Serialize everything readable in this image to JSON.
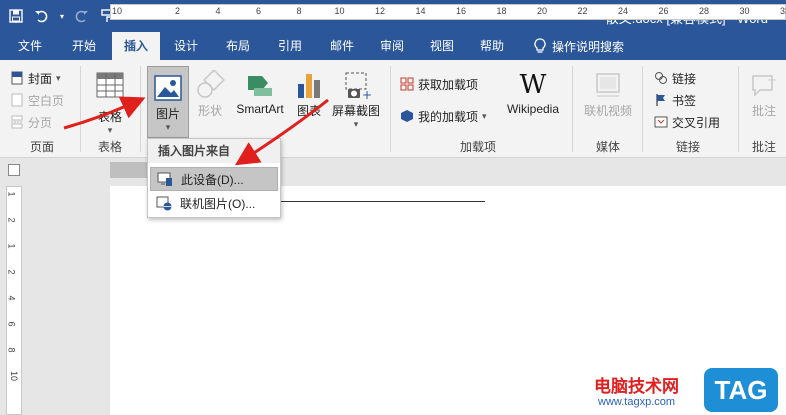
{
  "title": {
    "text": "散文.docx [兼容模式]  -  Word"
  },
  "qat": {
    "save": "save-icon",
    "undo": "undo-icon",
    "redo": "redo-icon",
    "format_painter": "format-painter-icon",
    "customize": "▾"
  },
  "tabs": [
    "文件",
    "开始",
    "插入",
    "设计",
    "布局",
    "引用",
    "邮件",
    "审阅",
    "视图",
    "帮助"
  ],
  "tellme": "操作说明搜索",
  "ribbon": {
    "pages": {
      "cover": "封面",
      "blank": "空白页",
      "break": "分页",
      "group": "页面"
    },
    "tables": {
      "table": "表格",
      "group": "表格"
    },
    "illustrations": {
      "pictures": "图片",
      "shapes": "形状",
      "smartart": "SmartArt",
      "chart": "图表",
      "screenshot": "屏幕截图"
    },
    "addins": {
      "get": "获取加载项",
      "my": "我的加载项",
      "wikipedia": "Wikipedia",
      "group": "加载项"
    },
    "media": {
      "online_video": "联机视频",
      "group": "媒体"
    },
    "links": {
      "link": "链接",
      "bookmark": "书签",
      "crossref": "交叉引用",
      "group": "链接"
    },
    "comments": {
      "comment": "批注",
      "group": "批注"
    }
  },
  "dropdown": {
    "header": "插入图片来自",
    "items": [
      "此设备(D)...",
      "联机图片(O)..."
    ]
  },
  "ruler": {
    "ticks": [
      "10",
      "2",
      "4",
      "6",
      "8",
      "10",
      "12",
      "14",
      "16",
      "18",
      "20",
      "22",
      "24",
      "26",
      "28",
      "30",
      "32"
    ],
    "vticks": [
      "1",
      "2",
      "1",
      "2",
      "4",
      "6",
      "8",
      "10"
    ]
  },
  "watermark": {
    "text": "电脑技术网",
    "url": "www.tagxp.com",
    "tag": "TAG"
  },
  "colors": {
    "accent": "#2b579a",
    "arrow": "#e0201c"
  }
}
